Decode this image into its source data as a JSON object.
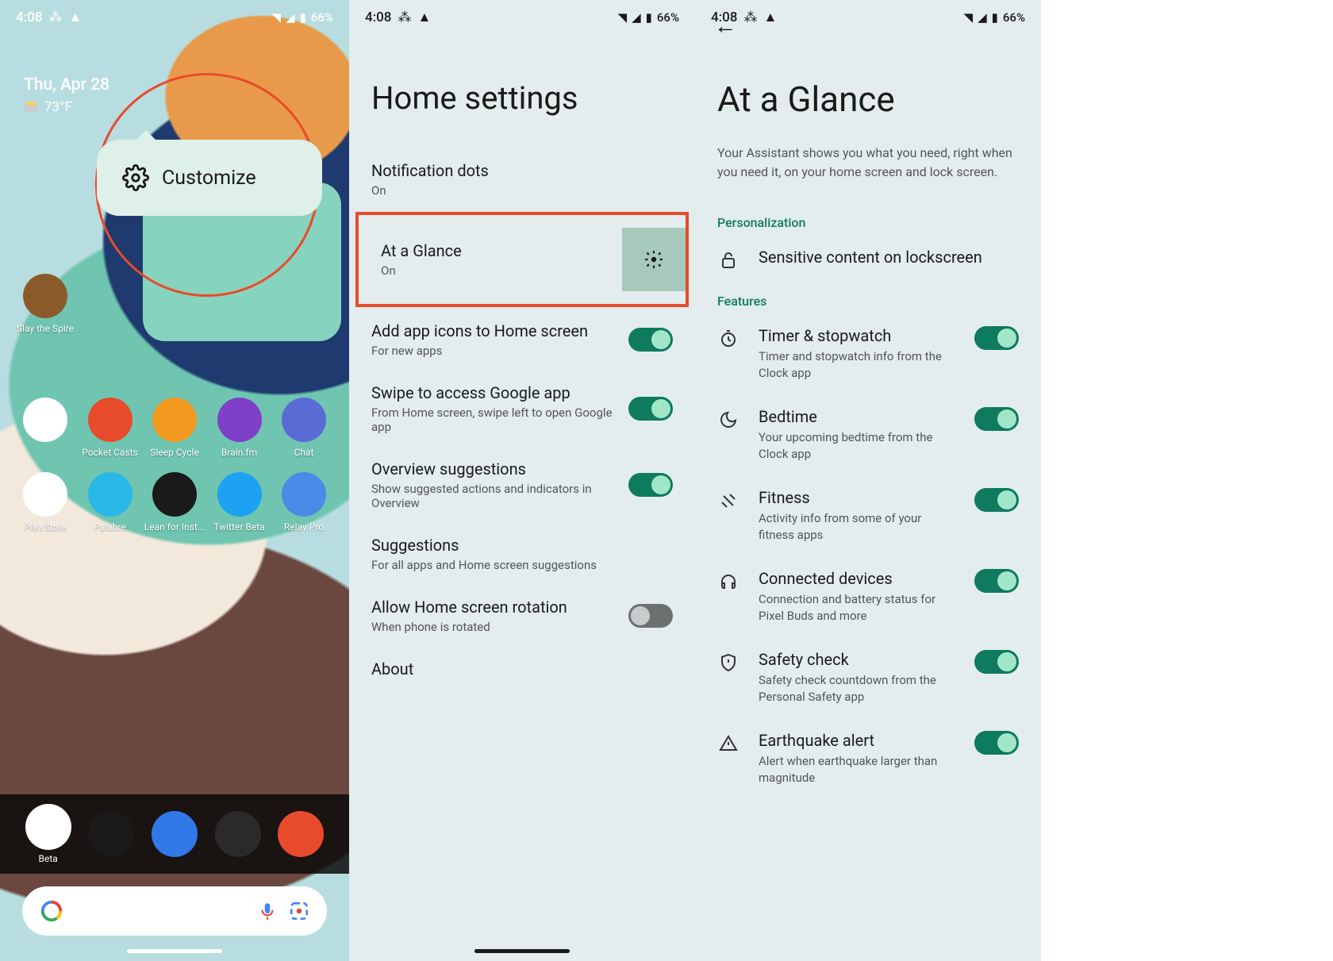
{
  "status": {
    "time": "4:08",
    "battery": "66%"
  },
  "panel1": {
    "date": "Thu, Apr 28",
    "temp": "73°F",
    "customize": "Customize",
    "apps_row1": [
      {
        "label": "Slay the Spire",
        "bg": "#8b5a2b"
      }
    ],
    "apps_row2": [
      {
        "label": "",
        "bg": "#fff"
      },
      {
        "label": "Pocket Casts",
        "bg": "#e84b2c"
      },
      {
        "label": "Sleep Cycle",
        "bg": "#f29a1f"
      },
      {
        "label": "Brain.fm",
        "bg": "#7e3fc9"
      },
      {
        "label": "Chat",
        "bg": "#5b6bd6"
      }
    ],
    "apps_row3": [
      {
        "label": "Play Store",
        "bg": "#fff"
      },
      {
        "label": "Palabre",
        "bg": "#29b8e8"
      },
      {
        "label": "Lean for Inst...",
        "bg": "#1a1a1a"
      },
      {
        "label": "Twitter Beta",
        "bg": "#1da1f2"
      },
      {
        "label": "Relay Pro",
        "bg": "#4a8be8"
      }
    ],
    "dock": [
      {
        "label": "Beta",
        "bg": "#fff"
      },
      {
        "label": "",
        "bg": "#1a1a1a"
      },
      {
        "label": "",
        "bg": "#3178e8"
      },
      {
        "label": "",
        "bg": "#2a2a2a"
      },
      {
        "label": "",
        "bg": "#e84b2c"
      }
    ]
  },
  "panel2": {
    "title": "Home settings",
    "items": [
      {
        "title": "Notification dots",
        "sub": "On",
        "toggle": null,
        "highlight": false
      },
      {
        "title": "At a Glance",
        "sub": "On",
        "toggle": null,
        "highlight": true,
        "gear": true
      },
      {
        "title": "Add app icons to Home screen",
        "sub": "For new apps",
        "toggle": "on"
      },
      {
        "title": "Swipe to access Google app",
        "sub": "From Home screen, swipe left to open Google app",
        "toggle": "on"
      },
      {
        "title": "Overview suggestions",
        "sub": "Show suggested actions and indicators in Overview",
        "toggle": "on"
      },
      {
        "title": "Suggestions",
        "sub": "For all apps and Home screen suggestions",
        "toggle": null
      },
      {
        "title": "Allow Home screen rotation",
        "sub": "When phone is rotated",
        "toggle": "off"
      },
      {
        "title": "About",
        "sub": "",
        "toggle": null
      }
    ]
  },
  "panel3": {
    "title": "At a Glance",
    "desc": "Your Assistant shows you what you need, right when you need it, on your home screen and lock screen.",
    "personalization_label": "Personalization",
    "sensitive": {
      "title": "Sensitive content on lockscreen"
    },
    "features_label": "Features",
    "features": [
      {
        "icon": "timer",
        "title": "Timer & stopwatch",
        "sub": "Timer and stopwatch info from the Clock app",
        "toggle": "on"
      },
      {
        "icon": "moon",
        "title": "Bedtime",
        "sub": "Your upcoming bedtime from the Clock app",
        "toggle": "on"
      },
      {
        "icon": "fitness",
        "title": "Fitness",
        "sub": "Activity info from some of your fitness apps",
        "toggle": "on"
      },
      {
        "icon": "headphones",
        "title": "Connected devices",
        "sub": "Connection and battery status for Pixel Buds and more",
        "toggle": "on"
      },
      {
        "icon": "shield",
        "title": "Safety check",
        "sub": "Safety check countdown from the Personal Safety app",
        "toggle": "on"
      },
      {
        "icon": "alert",
        "title": "Earthquake alert",
        "sub": "Alert when earthquake larger than magnitude",
        "toggle": "on"
      }
    ]
  }
}
